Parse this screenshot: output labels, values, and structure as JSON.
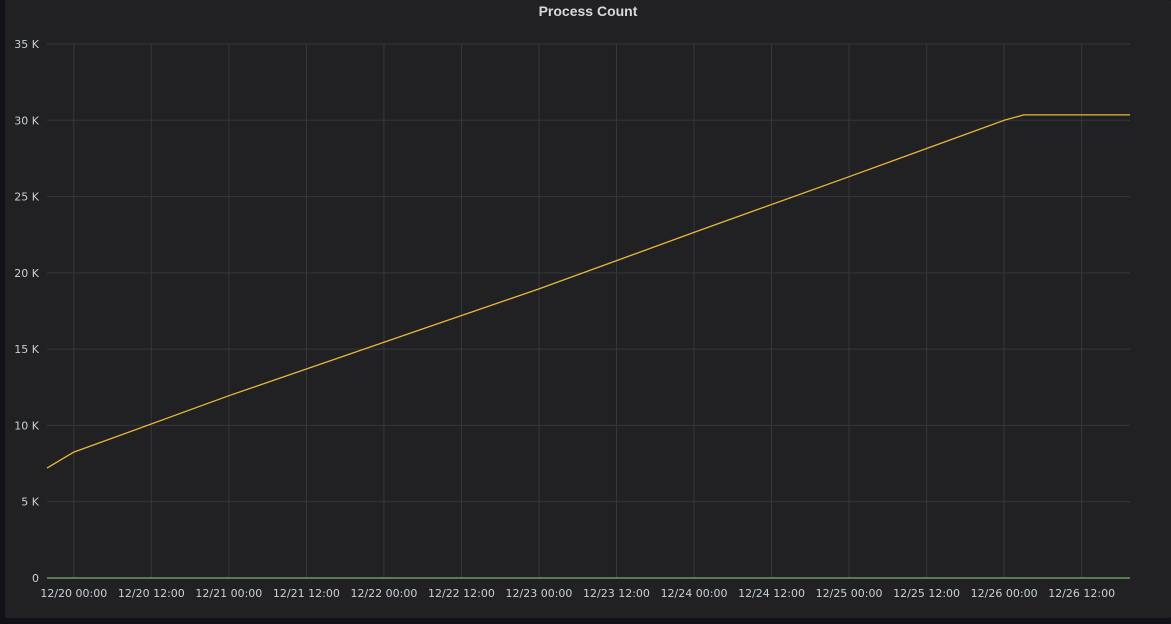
{
  "panel": {
    "title": "Process Count"
  },
  "chart_data": {
    "type": "line",
    "title": "Process Count",
    "xlabel": "",
    "ylabel": "",
    "ylim": [
      0,
      35000
    ],
    "yticks": [
      {
        "value": 0,
        "label": "0"
      },
      {
        "value": 5000,
        "label": "5 K"
      },
      {
        "value": 10000,
        "label": "10 K"
      },
      {
        "value": 15000,
        "label": "15 K"
      },
      {
        "value": 20000,
        "label": "20 K"
      },
      {
        "value": 25000,
        "label": "25 K"
      },
      {
        "value": 30000,
        "label": "30 K"
      },
      {
        "value": 35000,
        "label": "35 K"
      }
    ],
    "xlim": [
      "12/19 19:51",
      "12/26 19:29"
    ],
    "xticks": [
      {
        "value": "12/20 00:00",
        "label": "12/20 00:00"
      },
      {
        "value": "12/20 12:00",
        "label": "12/20 12:00"
      },
      {
        "value": "12/21 00:00",
        "label": "12/21 00:00"
      },
      {
        "value": "12/21 12:00",
        "label": "12/21 12:00"
      },
      {
        "value": "12/22 00:00",
        "label": "12/22 00:00"
      },
      {
        "value": "12/22 12:00",
        "label": "12/22 12:00"
      },
      {
        "value": "12/23 00:00",
        "label": "12/23 00:00"
      },
      {
        "value": "12/23 12:00",
        "label": "12/23 12:00"
      },
      {
        "value": "12/24 00:00",
        "label": "12/24 00:00"
      },
      {
        "value": "12/24 12:00",
        "label": "12/24 12:00"
      },
      {
        "value": "12/25 00:00",
        "label": "12/25 00:00"
      },
      {
        "value": "12/25 12:00",
        "label": "12/25 12:00"
      },
      {
        "value": "12/26 00:00",
        "label": "12/26 00:00"
      },
      {
        "value": "12/26 12:00",
        "label": "12/26 12:00"
      }
    ],
    "grid": true,
    "legend": "none",
    "series": [
      {
        "color": "#eab839",
        "points": [
          [
            "12/19 19:51",
            7200
          ],
          [
            "12/20 00:00",
            8250
          ],
          [
            "12/21 00:00",
            11950
          ],
          [
            "12/22 00:00",
            15450
          ],
          [
            "12/23 00:00",
            18950
          ],
          [
            "12/24 00:00",
            22650
          ],
          [
            "12/25 00:00",
            26300
          ],
          [
            "12/26 00:00",
            30000
          ],
          [
            "12/26 03:02",
            30350
          ],
          [
            "12/26 19:29",
            30350
          ]
        ]
      },
      {
        "color": "#7eb26d",
        "points": [
          [
            "12/19 19:51",
            0
          ],
          [
            "12/26 19:29",
            0
          ]
        ]
      }
    ]
  },
  "colors": {
    "panel_background": "#212124",
    "page_background": "#111217",
    "grid": "#37373b",
    "text": "#c7d0d9"
  }
}
